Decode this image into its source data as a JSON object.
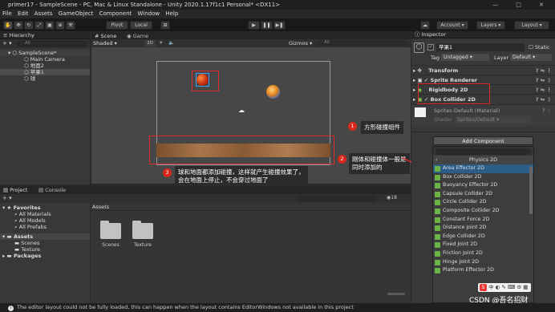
{
  "title_bar": {
    "app_title": "primer17 - SampleScene - PC, Mac & Linux Standalone - Unity 2020.1.17f1c1 Personal* <DX11>",
    "window_controls": "— □ ✕"
  },
  "menu": [
    "File",
    "Edit",
    "Assets",
    "GameObject",
    "Component",
    "Window",
    "Help"
  ],
  "toolbar": {
    "pivot": "Pivot",
    "local": "Local",
    "play": "▶",
    "pause": "❚❚",
    "step": "▶❚",
    "account": "Account",
    "layers": "Layers",
    "layout": "Layout"
  },
  "hierarchy": {
    "tab": "Hierarchy",
    "add_label": "+ ▾",
    "search_placeholder": "All",
    "items": [
      "SampleScene*",
      "Main Camera",
      "地面2",
      "苹果1",
      "球"
    ]
  },
  "scene_view": {
    "tabs": [
      "Scene",
      "Game"
    ],
    "shading": "Shaded",
    "mode_2d": "2D",
    "gizmos": "Gizmos",
    "search_placeholder": "All"
  },
  "annotations": [
    {
      "num": "1",
      "text": "方形碰撞组件"
    },
    {
      "num": "2",
      "text": "刚体和碰撞体一般是\n同时添加的"
    },
    {
      "num": "3",
      "text": "球和地面都添加碰撞，这样就产生碰撞效果了，\n会在地面上停止，不会穿过地面了"
    }
  ],
  "project": {
    "tabs": [
      "Project",
      "Console"
    ],
    "add_label": "+ ▾",
    "search_placeholder": "",
    "hidden_count": "18",
    "favorites_label": "Favorites",
    "favorites": [
      "All Materials",
      "All Models",
      "All Prefabs"
    ],
    "assets_label": "Assets",
    "asset_children": [
      "Scenes",
      "Texture"
    ],
    "packages_label": "Packages",
    "breadcrumb": "Assets",
    "folders": [
      "Scenes",
      "Texture"
    ]
  },
  "inspector": {
    "tab": "Inspector",
    "object_name": "苹果1",
    "static_label": "Static",
    "tag_label": "Tag",
    "tag_value": "Untagged",
    "layer_label": "Layer",
    "layer_value": "Default",
    "components": [
      "Transform",
      "Sprite Renderer",
      "Rigidbody 2D",
      "Box Collider 2D"
    ],
    "material_name": "Sprites-Default (Material)",
    "shader_label": "Shader",
    "shader_value": "Sprites/Default",
    "add_component": "Add Component",
    "search_placeholder": "",
    "category": "Physics 2D",
    "physics_items": [
      "Area Effector 2D",
      "Box Collider 2D",
      "Buoyancy Effector 2D",
      "Capsule Collider 2D",
      "Circle Collider 2D",
      "Composite Collider 2D",
      "Constant Force 2D",
      "Distance Joint 2D",
      "Edge Collider 2D",
      "Fixed Joint 2D",
      "Friction Joint 2D",
      "Hinge Joint 2D",
      "Platform Effector 2D"
    ],
    "selected_item": "Area Effector 2D"
  },
  "watermark": "CSDN @吾名招财",
  "ime_label": "中",
  "status_message": "The editor layout could not be fully loaded, this can happen when the layout contains EditorWindows not available in this project",
  "colors": {
    "annotation_red": "#e02a2a",
    "selection_blue": "#2c5d87",
    "component_green": "#6cb346"
  }
}
